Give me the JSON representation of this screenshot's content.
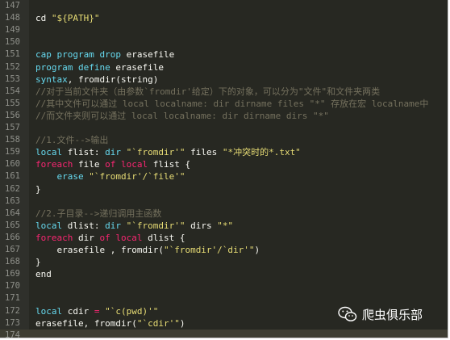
{
  "editor": {
    "lines": [
      {
        "n": "147",
        "segs": []
      },
      {
        "n": "148",
        "segs": [
          {
            "t": "cd ",
            "c": "fn"
          },
          {
            "t": "\"${PATH}\"",
            "c": "str"
          }
        ]
      },
      {
        "n": "149",
        "segs": []
      },
      {
        "n": "150",
        "segs": []
      },
      {
        "n": "151",
        "segs": [
          {
            "t": "cap program drop",
            "c": "kw"
          },
          {
            "t": " erasefile",
            "c": "fn"
          }
        ]
      },
      {
        "n": "152",
        "segs": [
          {
            "t": "program define",
            "c": "kw"
          },
          {
            "t": " erasefile",
            "c": "fn"
          }
        ]
      },
      {
        "n": "153",
        "segs": [
          {
            "t": "syntax",
            "c": "kw"
          },
          {
            "t": ", fromdir(string)",
            "c": "fn"
          }
        ]
      },
      {
        "n": "154",
        "segs": [
          {
            "t": "//对于当前文件夹（由参数`fromdir'给定）下的对象，可以分为\"文件\"和文件夹两类",
            "c": "cm"
          }
        ]
      },
      {
        "n": "155",
        "segs": [
          {
            "t": "//其中文件可以通过 local localname: dir dirname files \"*\" 存放在宏 localname中",
            "c": "cm"
          }
        ]
      },
      {
        "n": "156",
        "segs": [
          {
            "t": "//而文件夹则可以通过 local localname: dir dirname dirs \"*\"",
            "c": "cm"
          }
        ]
      },
      {
        "n": "157",
        "segs": []
      },
      {
        "n": "158",
        "segs": [
          {
            "t": "//1.文件-->输出",
            "c": "cm"
          }
        ]
      },
      {
        "n": "159",
        "segs": [
          {
            "t": "local",
            "c": "kw"
          },
          {
            "t": " flist: ",
            "c": "fn"
          },
          {
            "t": "dir",
            "c": "kw"
          },
          {
            "t": " ",
            "c": "fn"
          },
          {
            "t": "\"`fromdir'\"",
            "c": "str"
          },
          {
            "t": " files ",
            "c": "fn"
          },
          {
            "t": "\"*冲突时的*.txt\"",
            "c": "str"
          }
        ]
      },
      {
        "n": "160",
        "segs": [
          {
            "t": "foreach",
            "c": "kw2"
          },
          {
            "t": " file ",
            "c": "fn"
          },
          {
            "t": "of local",
            "c": "kw2"
          },
          {
            "t": " flist {",
            "c": "fn"
          }
        ]
      },
      {
        "n": "161",
        "segs": [
          {
            "t": "    ",
            "c": "fn"
          },
          {
            "t": "erase",
            "c": "kw"
          },
          {
            "t": " ",
            "c": "fn"
          },
          {
            "t": "\"`fromdir'/`file'\"",
            "c": "str"
          }
        ]
      },
      {
        "n": "162",
        "segs": [
          {
            "t": "}",
            "c": "fn"
          }
        ]
      },
      {
        "n": "163",
        "segs": []
      },
      {
        "n": "164",
        "segs": [
          {
            "t": "//2.子目录-->递归调用主函数",
            "c": "cm"
          }
        ]
      },
      {
        "n": "165",
        "segs": [
          {
            "t": "local",
            "c": "kw"
          },
          {
            "t": " dlist: ",
            "c": "fn"
          },
          {
            "t": "dir",
            "c": "kw"
          },
          {
            "t": " ",
            "c": "fn"
          },
          {
            "t": "\"`fromdir'\"",
            "c": "str"
          },
          {
            "t": " dirs ",
            "c": "fn"
          },
          {
            "t": "\"*\"",
            "c": "str"
          }
        ]
      },
      {
        "n": "166",
        "segs": [
          {
            "t": "foreach",
            "c": "kw2"
          },
          {
            "t": " dir ",
            "c": "fn"
          },
          {
            "t": "of local",
            "c": "kw2"
          },
          {
            "t": " dlist {",
            "c": "fn"
          }
        ]
      },
      {
        "n": "167",
        "segs": [
          {
            "t": "    erasefile , fromdir(",
            "c": "fn"
          },
          {
            "t": "\"`fromdir'/`dir'\"",
            "c": "str"
          },
          {
            "t": ")",
            "c": "fn"
          }
        ]
      },
      {
        "n": "168",
        "segs": [
          {
            "t": "}",
            "c": "fn"
          }
        ]
      },
      {
        "n": "169",
        "segs": [
          {
            "t": "end",
            "c": "fn"
          }
        ]
      },
      {
        "n": "170",
        "segs": []
      },
      {
        "n": "171",
        "segs": []
      },
      {
        "n": "172",
        "segs": [
          {
            "t": "local",
            "c": "kw"
          },
          {
            "t": " cdir ",
            "c": "fn"
          },
          {
            "t": "=",
            "c": "kw2"
          },
          {
            "t": " ",
            "c": "fn"
          },
          {
            "t": "\"`c(pwd)'\"",
            "c": "str"
          }
        ]
      },
      {
        "n": "173",
        "segs": [
          {
            "t": "erasefile, fromdir(",
            "c": "fn"
          },
          {
            "t": "\"`cdir'\"",
            "c": "str"
          },
          {
            "t": ")",
            "c": "fn"
          }
        ]
      },
      {
        "n": "174",
        "segs": [],
        "current": true
      }
    ]
  },
  "watermark": {
    "text": "爬虫俱乐部",
    "icon": "wechat-icon"
  },
  "colors": {
    "background": "#272822",
    "keyword": "#66d9ef",
    "keyword_control": "#f92672",
    "string": "#e6db74",
    "comment": "#75715e"
  }
}
